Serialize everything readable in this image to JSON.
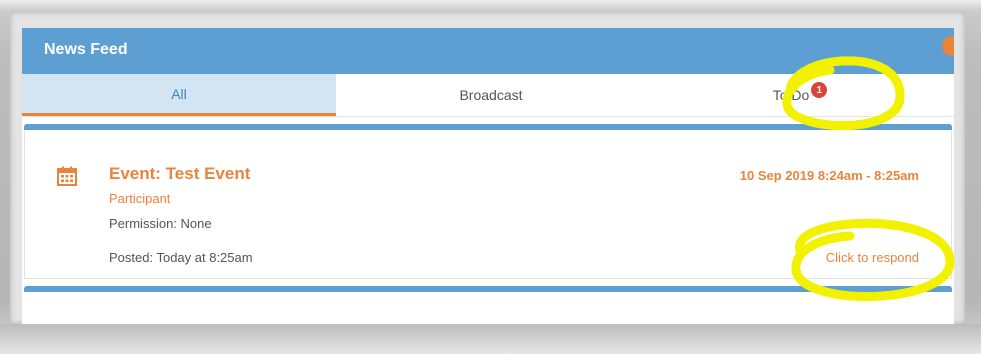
{
  "header": {
    "title": "News Feed"
  },
  "tabs": [
    {
      "label": "All",
      "active": true
    },
    {
      "label": "Broadcast",
      "active": false
    },
    {
      "label": "To Do",
      "active": false,
      "badge": "1"
    }
  ],
  "event_card": {
    "icon": "calendar-icon",
    "title": "Event: Test Event",
    "date_range": "10 Sep 2019 8:24am - 8:25am",
    "role": "Participant",
    "permission": "Permission: None",
    "posted": "Posted: Today at 8:25am",
    "action_label": "Click to respond"
  },
  "colors": {
    "header_blue": "#5d9fd2",
    "accent_orange": "#e8843c",
    "badge_red": "#d9453b",
    "highlight_yellow": "#f2f200"
  }
}
